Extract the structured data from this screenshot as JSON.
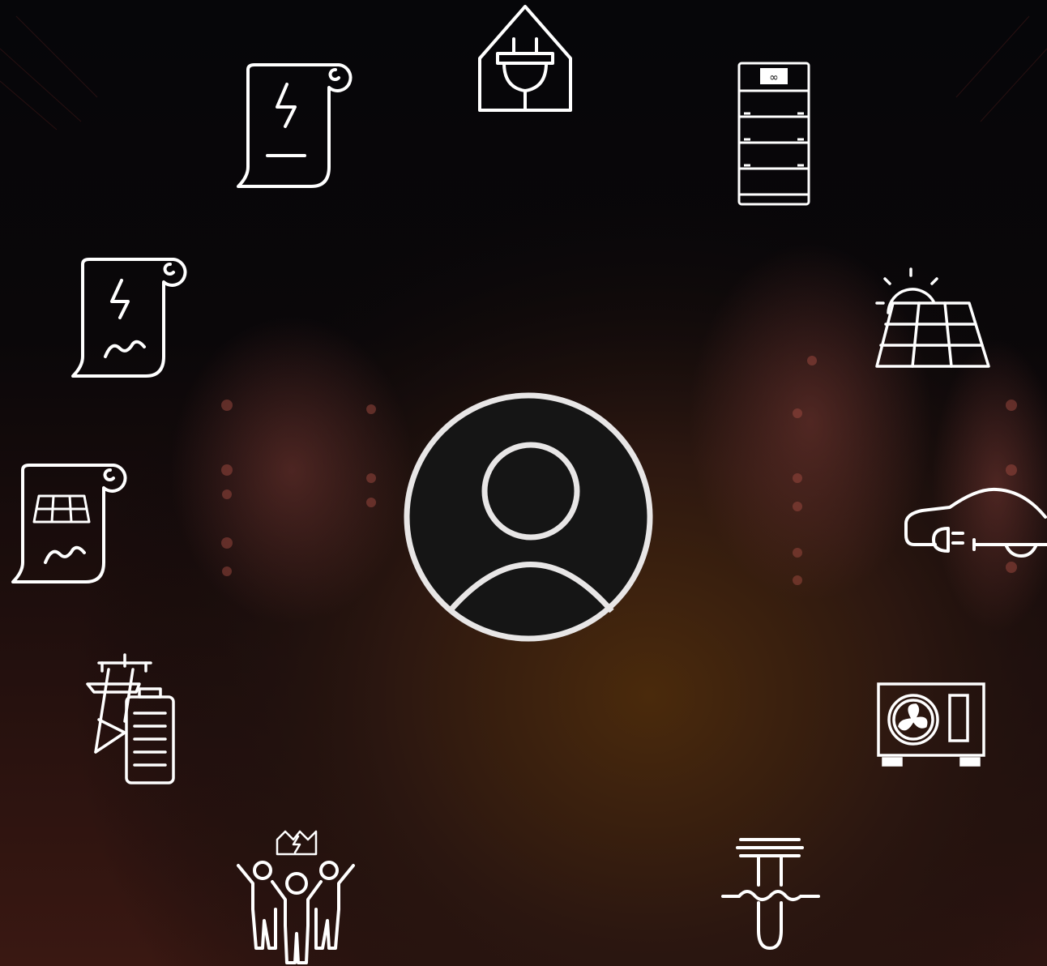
{
  "canvas": {
    "background": "#060609",
    "glow": "#4a2a0c",
    "stroke": "#ffffff"
  },
  "hub": {
    "icon": "user-profile-icon"
  },
  "icons": [
    {
      "name": "home-plug-icon"
    },
    {
      "name": "battery-storage-cabinet-icon"
    },
    {
      "name": "solar-panel-sun-icon"
    },
    {
      "name": "electric-car-plug-icon"
    },
    {
      "name": "heat-pump-outdoor-unit-icon"
    },
    {
      "name": "geothermal-pipe-icon"
    },
    {
      "name": "energy-community-icon"
    },
    {
      "name": "grid-battery-icon"
    },
    {
      "name": "solar-contract-scroll-icon"
    },
    {
      "name": "signed-energy-contract-icon"
    },
    {
      "name": "energy-contract-scroll-icon"
    }
  ]
}
